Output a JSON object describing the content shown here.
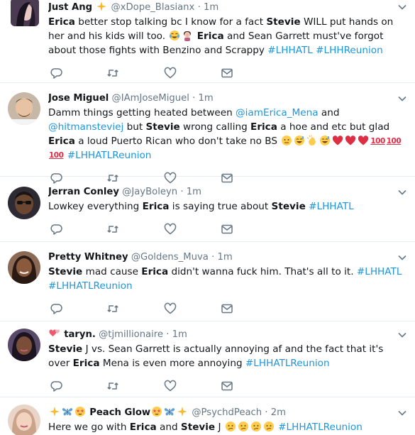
{
  "tweets": [
    {
      "name": "Just Ang",
      "name_suffix_emoji": [
        "sparkles-emoji"
      ],
      "handle": "@xDope_Blasianx",
      "dot": "·",
      "time": "1m",
      "text": {
        "t1": "Erica",
        "t2": " better stop talking bc I know for a fact ",
        "t3": "Stevie",
        "t4": " WILL put hands on her and his kids will too. ",
        "t5": "Erica",
        "t6": " and Sean Garrett must've forgot about those fights with Benzino and Scrappy ",
        "t7": "#LHHATL",
        "t8": " ",
        "t9": "#LHHReunion"
      },
      "emojis": [
        "tears-of-joy-emoji",
        "facepalm-emoji"
      ]
    },
    {
      "name": "Jose Miguel",
      "handle": "@IAmJoseMiguel",
      "dot": "·",
      "time": "1m",
      "text": {
        "t1": "Damm things getting heated between ",
        "t2": "@iamErica_Mena",
        "t3": " and ",
        "t4": "@hitmansteviej",
        "t5": " but ",
        "t6": "Stevie",
        "t7": " wrong calling ",
        "t8": "Erica",
        "t9": " a hoe and etc but glad ",
        "t10": "Erica",
        "t11": " a loud Puerto Rican who don't take no BS ",
        "t12": "100",
        "t13": "#LHHATLReunion"
      },
      "emojis": [
        "face-emoji",
        "grin-sweat-emoji",
        "clap-emoji",
        "grin-sweat-emoji",
        "red-heart-emoji",
        "red-heart-emoji",
        "red-heart-emoji",
        "hundred-emoji",
        "hundred-emoji",
        "hundred-emoji"
      ]
    },
    {
      "name": "Jerran Conley",
      "handle": "@JayBoleyn",
      "dot": "·",
      "time": "1m",
      "text": {
        "t1": "Lowkey everything ",
        "t2": "Erica",
        "t3": " is saying true about ",
        "t4": "Stevie",
        "t5": " ",
        "t6": "#LHHATL"
      }
    },
    {
      "name": "Pretty Whitney",
      "handle": "@Goldens_Muva",
      "dot": "·",
      "time": "1m",
      "text": {
        "t1": "Stevie",
        "t2": " mad cause ",
        "t3": "Erica",
        "t4": " didn't wanna fuck him. That's all to it. ",
        "t5": "#LHHATL",
        "t6": " ",
        "t7": "#LHHATLReunion"
      }
    },
    {
      "name": "taryn.",
      "name_prefix_emoji": [
        "two-hearts-emoji"
      ],
      "handle": "@tjmillionaire",
      "dot": "·",
      "time": "1m",
      "text": {
        "t1": "Stevie",
        "t2": " J vs. Sean Garrett is actually annoying af and the fact that it's over ",
        "t3": "Erica",
        "t4": " Mena is even more annoying ",
        "t5": "#LHHATLReunion"
      }
    },
    {
      "name": "Peach Glow",
      "name_prefix_emoji": [
        "sparkles-emoji",
        "butterfly-emoji",
        "star-eyes-emoji"
      ],
      "name_suffix_emoji": [
        "star-eyes-emoji",
        "butterfly-emoji",
        "sparkles-emoji"
      ],
      "handle": "@PsychdPeach",
      "dot": "·",
      "time": "2m",
      "text": {
        "t1": "Here we go with ",
        "t2": "Erica",
        "t3": " and ",
        "t4": "Stevie",
        "t5": " J ",
        "t6": "#LHHATLReunion"
      },
      "emojis": [
        "confused-emoji",
        "confused-emoji",
        "confused-emoji",
        "confused-emoji"
      ]
    }
  ],
  "icons": {
    "reply": "reply-icon",
    "retweet": "retweet-icon",
    "like": "heart-icon",
    "dm": "envelope-icon",
    "more": "chevron-down-icon"
  },
  "colors": {
    "link": "#1b95e0",
    "secondary": "#657786",
    "divider": "#e6ecf0",
    "icon": "#657786"
  }
}
